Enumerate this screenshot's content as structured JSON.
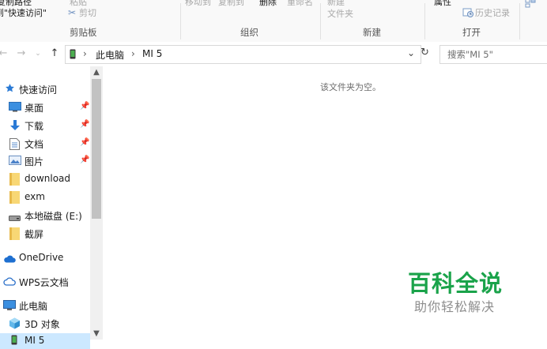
{
  "ribbon": {
    "top_row": [
      {
        "name": "copy-path-partial",
        "text": "复制路径",
        "dim": false
      },
      {
        "name": "paste-shortcut-partial",
        "text": "粘贴",
        "dim": true
      },
      {
        "name": "move-to-partial",
        "text": "移动到",
        "dim": true
      },
      {
        "name": "copy-to-partial",
        "text": "复制到",
        "dim": true
      },
      {
        "name": "delete-partial",
        "text": "删除",
        "dim": false
      },
      {
        "name": "rename-partial",
        "text": "重命名",
        "dim": true
      },
      {
        "name": "new-folder-partial",
        "text": "新建",
        "dim": true
      },
      {
        "name": "properties-partial",
        "text": "属性",
        "dim": false
      }
    ],
    "quick_access_pin_label": "到\"快速访问\"",
    "cut_label": "剪切",
    "new_folder_sub": "文件夹",
    "history_label": "历史记录",
    "groups": {
      "clipboard": "剪贴板",
      "organize": "组织",
      "new": "新建",
      "open": "打开"
    }
  },
  "address": {
    "crumbs": [
      "此电脑",
      "MI 5"
    ],
    "separator": "›",
    "search_placeholder": "搜索\"MI 5\""
  },
  "nav": {
    "quick_access": "快速访问",
    "items": [
      {
        "label": "桌面",
        "pinned": true
      },
      {
        "label": "下载",
        "pinned": true
      },
      {
        "label": "文档",
        "pinned": true
      },
      {
        "label": "图片",
        "pinned": true
      },
      {
        "label": "download",
        "pinned": false
      },
      {
        "label": "exm",
        "pinned": false
      },
      {
        "label": "本地磁盘 (E:)",
        "pinned": false
      },
      {
        "label": "截屏",
        "pinned": false
      }
    ],
    "onedrive": "OneDrive",
    "wps": "WPS云文档",
    "this_pc": "此电脑",
    "pc_items": [
      {
        "label": "3D 对象"
      },
      {
        "label": "MI 5"
      }
    ]
  },
  "content": {
    "empty_message": "该文件夹为空。"
  },
  "watermark": {
    "title": "百科全说",
    "subtitle": "助你轻松解决"
  },
  "colors": {
    "accent": "#1aa34a",
    "folder": "#f8d775",
    "pin": "#8a8a8a"
  }
}
